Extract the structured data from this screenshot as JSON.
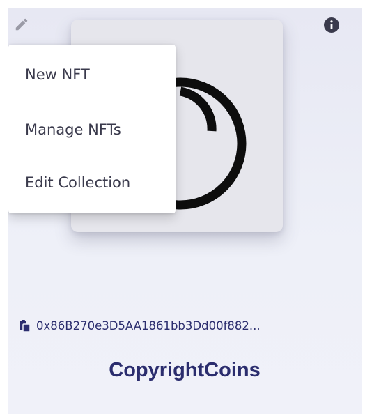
{
  "card": {
    "edit_icon": "pencil-icon",
    "info_icon": "info-icon",
    "image_logo": "copyright-c-logo",
    "address": "0x86B270e3D5AA1861bb3Dd00f882...",
    "copy_icon": "copy-icon",
    "title": "CopyrightCoins"
  },
  "menu": {
    "items": [
      {
        "label": "New NFT"
      },
      {
        "label": "Manage NFTs"
      },
      {
        "label": "Edit Collection"
      }
    ]
  },
  "colors": {
    "card_bg": "#e9eaf4",
    "title": "#2b2d6e",
    "menu_text": "#3a3a4c",
    "icon_gray": "#9a9aa6",
    "info_dark": "#3a3a4c"
  }
}
